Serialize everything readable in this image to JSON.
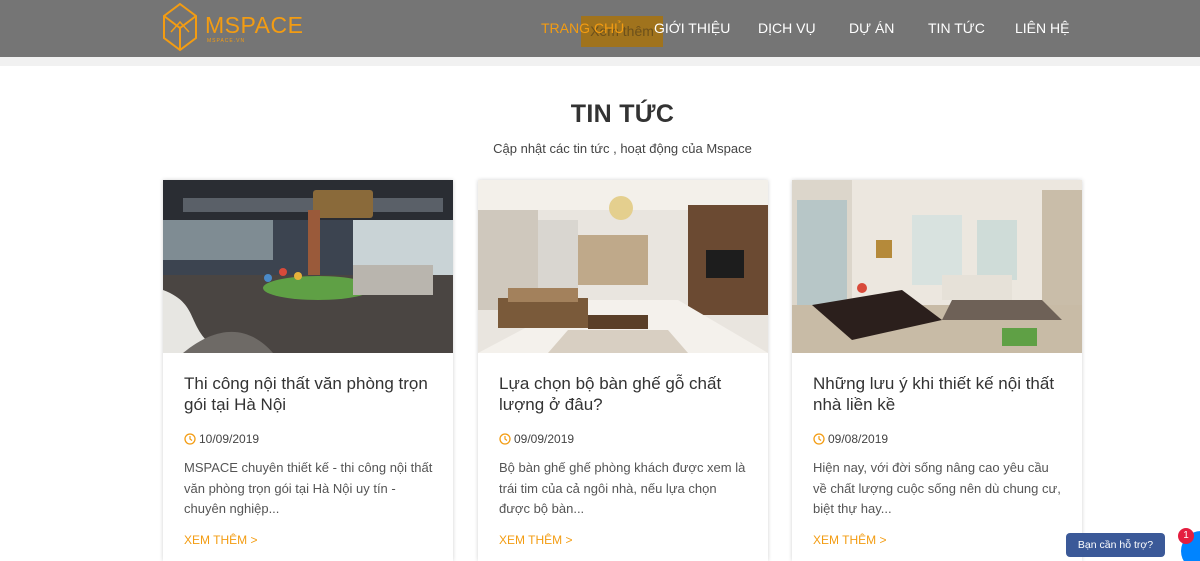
{
  "brand": {
    "name": "MSPACE",
    "tagline": "MSPACE.VN",
    "accent": "#f39c12"
  },
  "nav": {
    "items": [
      {
        "label": "TRANG CHỦ",
        "active": true
      },
      {
        "label": "GIỚI THIỆU",
        "active": false
      },
      {
        "label": "DỊCH VỤ",
        "active": false
      },
      {
        "label": "DỰ ÁN",
        "active": false
      },
      {
        "label": "TIN TỨC",
        "active": false
      },
      {
        "label": "LIÊN HỆ",
        "active": false
      }
    ],
    "overlay_button": "Xem thêm"
  },
  "section": {
    "title": "TIN TỨC",
    "subtitle": "Cập nhật các tin tức , hoạt động của Mspace"
  },
  "posts": [
    {
      "title": "Thi công nội thất văn phòng trọn gói tại Hà Nội",
      "date": "10/09/2019",
      "excerpt": "MSPACE chuyên thiết kế - thi công nội thất văn phòng trọn gói tại Hà Nội uy tín - chuyên nghiệp...",
      "more": "XEM THÊM >",
      "image": "office-interior-photo"
    },
    {
      "title": "Lựa chọn bộ bàn ghế gỗ chất lượng ở đâu?",
      "date": "09/09/2019",
      "excerpt": "Bộ bàn ghế ghế phòng khách được xem là trái tim của cả ngôi nhà, nếu lựa chọn được bộ bàn...",
      "more": "XEM THÊM >",
      "image": "living-room-photo"
    },
    {
      "title": "Những lưu ý khi thiết kế nội thất nhà liền kề",
      "date": "09/08/2019",
      "excerpt": "Hiện nay, với đời sống nâng cao yêu cầu về chất lượng cuộc sống nên dù chung cư, biệt thự hay...",
      "more": "XEM THÊM >",
      "image": "apartment-dining-photo"
    }
  ],
  "chat": {
    "support_label": "Bạn cần hỗ trợ?",
    "unread": "1"
  }
}
